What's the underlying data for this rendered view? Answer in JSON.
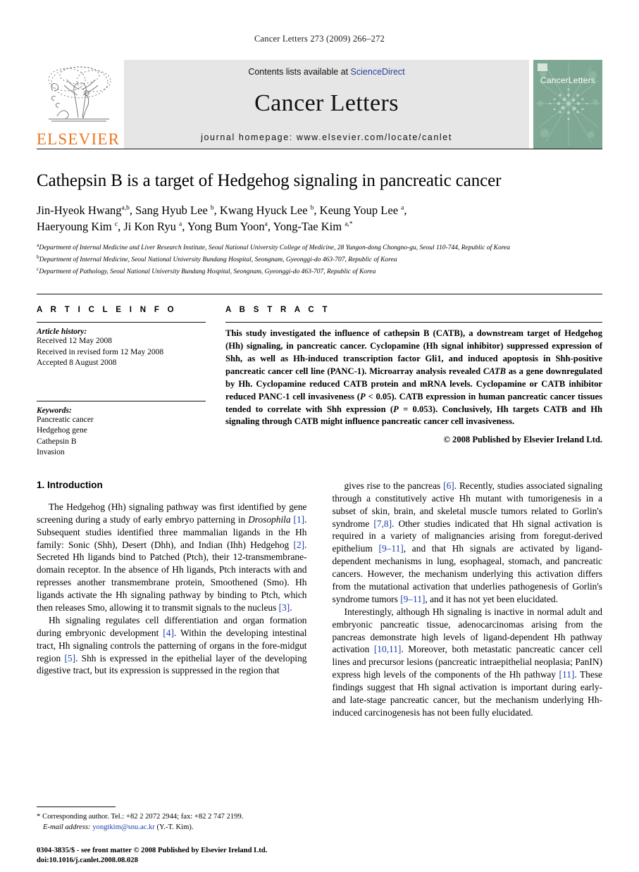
{
  "running_head": "Cancer Letters 273 (2009) 266–272",
  "masthead": {
    "publisher_wordmark": "ELSEVIER",
    "contents_prefix": "Contents lists available at ",
    "contents_link": "ScienceDirect",
    "journal_name": "Cancer Letters",
    "homepage": "journal homepage: www.elsevier.com/locate/canlet",
    "cover_title": "CancerLetters",
    "accent_orange": "#E87722",
    "link_blue": "#2b3f9e",
    "cover_green": "#7fa894",
    "panel_grey": "#e6e6e6"
  },
  "article": {
    "title": "Cathepsin B is a target of Hedgehog signaling in pancreatic cancer",
    "authors_line_1": "Jin-Hyeok Hwang<sup>a,b</sup>, Sang Hyub Lee <sup>b</sup>, Kwang Hyuck Lee <sup>b</sup>, Keung Youp Lee <sup>a</sup>,",
    "authors_line_2": "Haeryoung Kim <sup>c</sup>, Ji Kon Ryu <sup>a</sup>, Yong Bum Yoon<sup>a</sup>, Yong-Tae Kim <sup>a,*</sup>",
    "affiliations": [
      "<sup>a</sup>Department of Internal Medicine and Liver Research Institute, Seoul National University College of Medicine, 28 Yungon-dong Chongno-gu, Seoul 110-744, Republic of Korea",
      "<sup>b</sup>Department of Internal Medicine, Seoul National University Bundang Hospital, Seongnam, Gyeonggi-do 463-707, Republic of Korea",
      "<sup>c</sup>Department of Pathology, Seoul National University Bundang Hospital, Seongnam, Gyeonggi-do 463-707, Republic of Korea"
    ]
  },
  "article_info": {
    "heading": "A R T I C L E  I N F O",
    "history_label": "Article history:",
    "history": [
      "Received 12 May 2008",
      "Received in revised form 12 May 2008",
      "Accepted 8 August 2008"
    ],
    "keywords_label": "Keywords:",
    "keywords": [
      "Pancreatic cancer",
      "Hedgehog gene",
      "Cathepsin B",
      "Invasion"
    ]
  },
  "abstract": {
    "heading": "A B S T R A C T",
    "text": "This study investigated the influence of cathepsin B (CATB), a downstream target of Hedgehog (Hh) signaling, in pancreatic cancer. Cyclopamine (Hh signal inhibitor) suppressed expression of Shh, as well as Hh-induced transcription factor Gli1, and induced apoptosis in Shh-positive pancreatic cancer cell line (PANC-1). Microarray analysis revealed <i>CATB</i> as a gene downregulated by Hh. Cyclopamine reduced CATB protein and mRNA levels. Cyclopamine or CATB inhibitor reduced PANC-1 cell invasiveness (<i>P</i> &lt; 0.05). CATB expression in human pancreatic cancer tissues tended to correlate with Shh expression (<i>P</i> = 0.053). Conclusively, Hh targets CATB and Hh signaling through CATB might influence pancreatic cancer cell invasiveness.",
    "copyright": "© 2008 Published by Elsevier Ireland Ltd."
  },
  "body": {
    "section_heading": "1. Introduction",
    "left_paragraphs": [
      "The Hedgehog (Hh) signaling pathway was first identified by gene screening during a study of early embryo patterning in <i>Drosophila</i> <span class=\"ref\">[1]</span>. Subsequent studies identified three mammalian ligands in the Hh family: Sonic (Shh), Desert (Dhh), and Indian (Ihh) Hedgehog <span class=\"ref\">[2]</span>. Secreted Hh ligands bind to Patched (Ptch), their 12-transmembrane-domain receptor. In the absence of Hh ligands, Ptch interacts with and represses another transmembrane protein, Smoothened (Smo). Hh ligands activate the Hh signaling pathway by binding to Ptch, which then releases Smo, allowing it to transmit signals to the nucleus <span class=\"ref\">[3]</span>.",
      "Hh signaling regulates cell differentiation and organ formation during embryonic development <span class=\"ref\">[4]</span>. Within the developing intestinal tract, Hh signaling controls the patterning of organs in the fore-midgut region <span class=\"ref\">[5]</span>. Shh is expressed in the epithelial layer of the developing digestive tract, but its expression is suppressed in the region that"
    ],
    "right_paragraphs": [
      "gives rise to the pancreas <span class=\"ref\">[6]</span>. Recently, studies associated signaling through a constitutively active Hh mutant with tumorigenesis in a subset of skin, brain, and skeletal muscle tumors related to Gorlin's syndrome <span class=\"ref\">[7,8]</span>. Other studies indicated that Hh signal activation is required in a variety of malignancies arising from foregut-derived epithelium <span class=\"ref\">[9–11]</span>, and that Hh signals are activated by ligand-dependent mechanisms in lung, esophageal, stomach, and pancreatic cancers. However, the mechanism underlying this activation differs from the mutational activation that underlies pathogenesis of Gorlin's syndrome tumors <span class=\"ref\">[9–11]</span>, and it has not yet been elucidated.",
      "Interestingly, although Hh signaling is inactive in normal adult and embryonic pancreatic tissue, adenocarcinomas arising from the pancreas demonstrate high levels of ligand-dependent Hh pathway activation <span class=\"ref\">[10,11]</span>. Moreover, both metastatic pancreatic cancer cell lines and precursor lesions (pancreatic intraepithelial neoplasia; PanIN) express high levels of the components of the Hh pathway <span class=\"ref\">[11]</span>. These findings suggest that Hh signal activation is important during early- and late-stage pancreatic cancer, but the mechanism underlying Hh-induced carcinogenesis has not been fully elucidated."
    ]
  },
  "footnote": {
    "marker": "*",
    "corresponding": "Corresponding author. Tel.: +82 2 2072 2944; fax: +82 2 747 2199.",
    "email_label": "E-mail address:",
    "email": "yongtkim@snu.ac.kr",
    "email_owner": "(Y.-T. Kim)."
  },
  "imprint": {
    "line1": "0304-3835/$ - see front matter © 2008 Published by Elsevier Ireland Ltd.",
    "line2": "doi:10.1016/j.canlet.2008.08.028"
  }
}
